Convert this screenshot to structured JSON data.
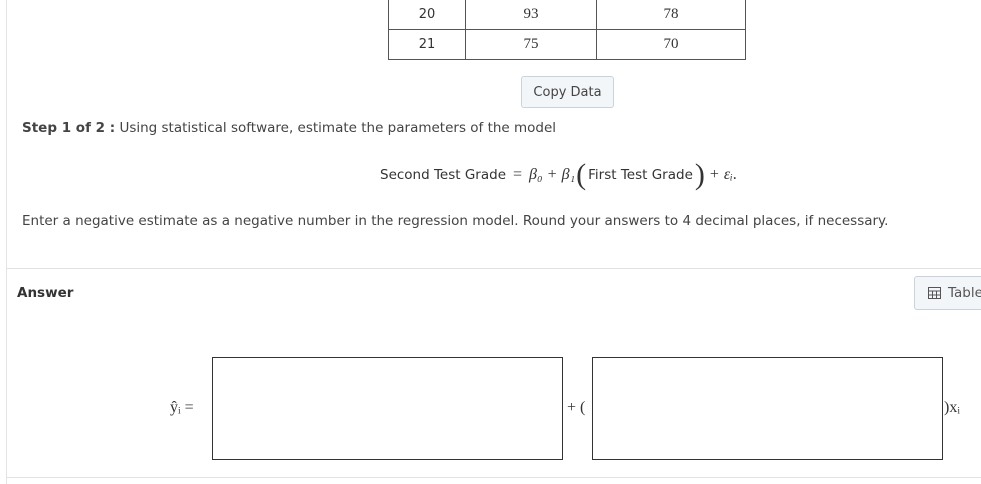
{
  "data_table": {
    "rows": [
      [
        "20",
        "93",
        "78"
      ],
      [
        "21",
        "75",
        "70"
      ]
    ]
  },
  "copy_button_label": "Copy Data",
  "step": {
    "prefix": "Step 1 of 2 :",
    "text": "Using statistical software, estimate the parameters of the model"
  },
  "model": {
    "lhs": "Second Test Grade",
    "equals": "=",
    "beta0": "β₀",
    "plus1": "+",
    "beta1": "β₁",
    "open_paren": "(",
    "x_label": "First Test Grade",
    "close_paren": ")",
    "plus2": "+",
    "error": "εᵢ",
    "period": "."
  },
  "instructions": "Enter a negative estimate as a negative number in the regression model. Round your answers to 4 decimal places, if necessary.",
  "answer": {
    "label": "Answer",
    "table_button_label": "Table",
    "yhat_text": "ŷᵢ  =",
    "plus_paren": "+ (",
    "close_x": ")xᵢ",
    "intercept_value": "",
    "slope_value": ""
  },
  "colors": {
    "border": "#555555",
    "button_bg": "#f3f6f9",
    "button_border": "#c9d3dd"
  }
}
